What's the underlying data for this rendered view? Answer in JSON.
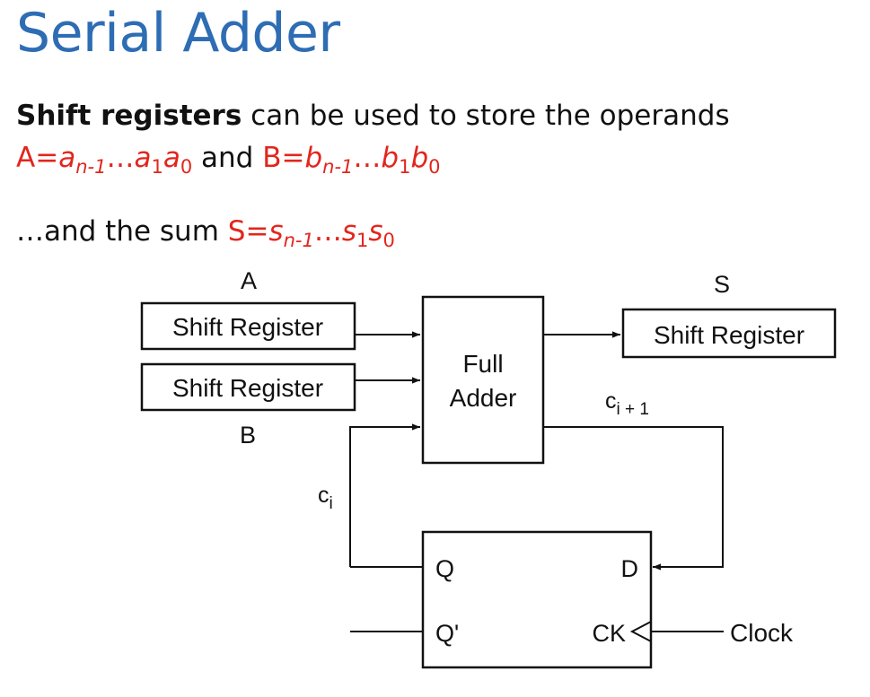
{
  "slide": {
    "title": "Serial Adder",
    "line1": {
      "bold": "Shift registers",
      "rest": " can be used to store the operands"
    },
    "line2": {
      "a_eq": "A=",
      "a_hi": "a",
      "a_hi_sub": "n-1",
      "a_dots": "…",
      "a_1": "a",
      "a_1_sub": "1",
      "a_0": "a",
      "a_0_sub": "0",
      "and": " and ",
      "b_eq": "B=",
      "b_hi": "b",
      "b_hi_sub": "n-1",
      "b_dots": "…",
      "b_1": "b",
      "b_1_sub": "1",
      "b_0": "b",
      "b_0_sub": "0"
    },
    "line3": {
      "prefix": "…and the sum ",
      "s_eq": "S=",
      "s_hi": "s",
      "s_hi_sub": "n-1",
      "s_dots": "…",
      "s_1": "s",
      "s_1_sub": "1",
      "s_0": "s",
      "s_0_sub": "0"
    }
  },
  "diagram": {
    "label_a": "A",
    "label_b": "B",
    "label_s": "S",
    "shift_register_a": "Shift Register",
    "shift_register_b": "Shift Register",
    "shift_register_s": "Shift Register",
    "full_adder_line1": "Full",
    "full_adder_line2": "Adder",
    "carry_out_c": "c",
    "carry_out_sub": "i + 1",
    "carry_in_c": "c",
    "carry_in_sub": "i",
    "ff_q": "Q",
    "ff_qbar": "Q'",
    "ff_d": "D",
    "ff_ck": "CK",
    "clock": "Clock"
  }
}
